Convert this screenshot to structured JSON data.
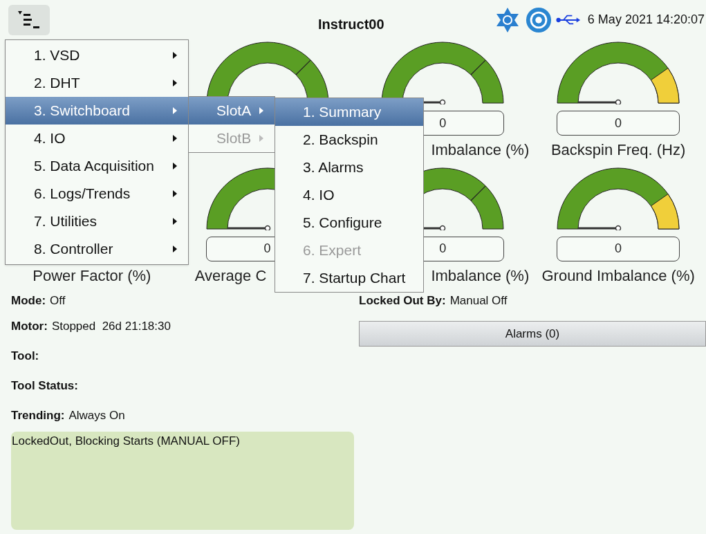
{
  "header": {
    "title": "Instruct00",
    "datetime": "6 May 2021 14:20:07"
  },
  "gauge_rows": [
    [
      null,
      {
        "warning": false
      },
      {
        "label": "Imbalance (%)",
        "value": "0",
        "warning": false
      },
      {
        "label": "Backspin Freq. (Hz)",
        "value": "0",
        "warning": true
      }
    ],
    [
      {
        "label": "Power Factor (%)"
      },
      {
        "label": "Average C",
        "value": "0"
      },
      {
        "label": "Imbalance (%)",
        "value": "0",
        "warning": false
      },
      {
        "label": "Ground Imbalance (%)",
        "value": "0",
        "warning": true
      }
    ]
  ],
  "info": [
    {
      "label": "Mode:",
      "value": "Off"
    },
    {
      "label": "Motor:",
      "value": "Stopped  26d 21:18:30"
    },
    {
      "label": "Tool:"
    },
    {
      "label": "Tool Status:"
    },
    {
      "label": "Trending:",
      "value": "Always On"
    }
  ],
  "status_message": "LockedOut, Blocking Starts (MANUAL OFF)",
  "locked_out": {
    "label": "Locked Out By:",
    "value": "Manual Off"
  },
  "alarms_button": "Alarms (0)",
  "menu": [
    {
      "label": "1. VSD",
      "selected": false
    },
    {
      "label": "2. DHT",
      "selected": false
    },
    {
      "label": "3. Switchboard",
      "selected": true
    },
    {
      "label": "4. IO",
      "selected": false
    },
    {
      "label": "5. Data Acquisition",
      "selected": false
    },
    {
      "label": "6. Logs/Trends",
      "selected": false
    },
    {
      "label": "7. Utilities",
      "selected": false
    },
    {
      "label": "8. Controller",
      "selected": false
    }
  ],
  "submenu": [
    {
      "label": "SlotA",
      "selected": true,
      "disabled": false
    },
    {
      "label": "SlotB",
      "selected": false,
      "disabled": true
    }
  ],
  "subsubmenu": [
    {
      "label": "1. Summary",
      "selected": true,
      "disabled": false
    },
    {
      "label": "2. Backspin",
      "selected": false,
      "disabled": false
    },
    {
      "label": "3. Alarms",
      "selected": false,
      "disabled": false
    },
    {
      "label": "4. IO",
      "selected": false,
      "disabled": false
    },
    {
      "label": "5. Configure",
      "selected": false,
      "disabled": false
    },
    {
      "label": "6. Expert",
      "selected": false,
      "disabled": true
    },
    {
      "label": "7. Startup Chart",
      "selected": false,
      "disabled": false
    }
  ]
}
